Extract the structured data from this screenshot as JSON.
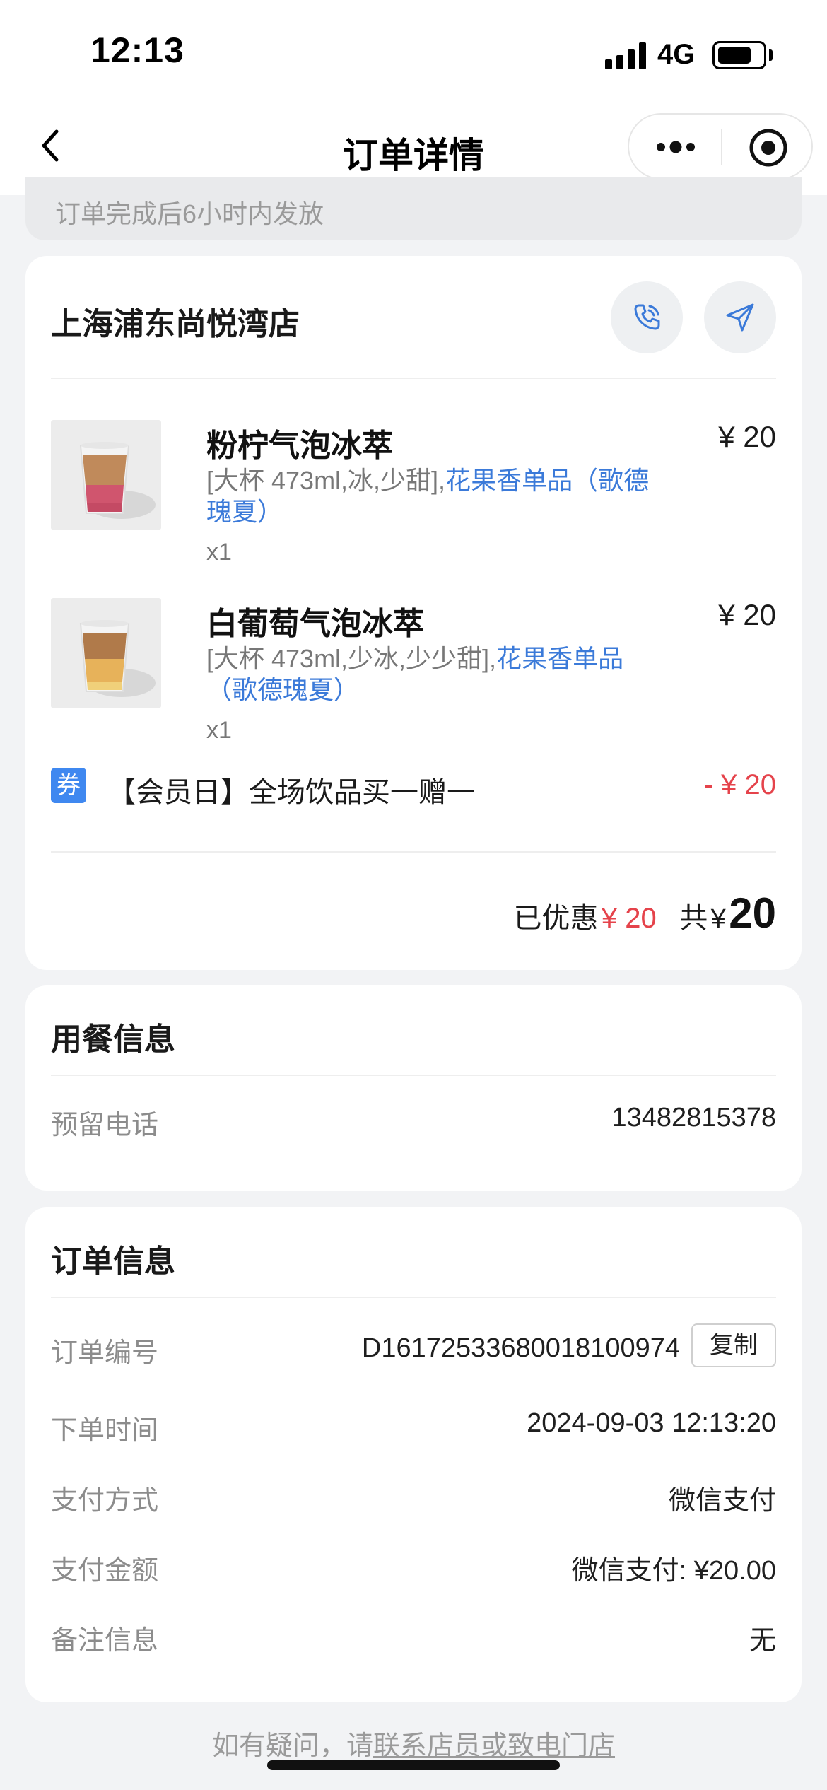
{
  "status_bar": {
    "time": "12:13",
    "network": "4G"
  },
  "nav": {
    "title": "订单详情"
  },
  "notice": {
    "text": "订单完成后6小时内发放"
  },
  "store": {
    "name": "上海浦东尚悦湾店",
    "items": [
      {
        "name": "粉柠气泡冰萃",
        "price": "¥ 20",
        "spec": "[大杯 473ml,冰,少甜],",
        "flavor": "花果香单品（歌德瑰夏）",
        "qty": "x1"
      },
      {
        "name": "白葡萄气泡冰萃",
        "price": "¥ 20",
        "spec": "[大杯 473ml,少冰,少少甜],",
        "flavor": "花果香单品（歌德瑰夏）",
        "qty": "x1"
      }
    ],
    "coupon": {
      "badge": "券",
      "text": "【会员日】全场饮品买一赠一",
      "amount": "- ¥ 20"
    },
    "summary": {
      "discount_label": "已优惠",
      "discount": "¥ 20",
      "total_label": "共",
      "currency": "¥",
      "total": "20"
    }
  },
  "dine_info": {
    "title": "用餐信息",
    "phone_label": "预留电话",
    "phone": "13482815378"
  },
  "order_info": {
    "title": "订单信息",
    "rows": [
      {
        "label": "订单编号",
        "value": "D16172533680018100974"
      },
      {
        "label": "下单时间",
        "value": "2024-09-03 12:13:20"
      },
      {
        "label": "支付方式",
        "value": "微信支付"
      },
      {
        "label": "支付金额",
        "value": "微信支付: ¥20.00"
      },
      {
        "label": "备注信息",
        "value": "无"
      }
    ],
    "copy_label": "复制"
  },
  "footer": {
    "prefix": "如有疑问，请",
    "link": "联系店员或致电门店"
  },
  "colors": {
    "accent_blue": "#3b7ad9",
    "price_red": "#e5434b",
    "badge_blue": "#3f88f0"
  }
}
